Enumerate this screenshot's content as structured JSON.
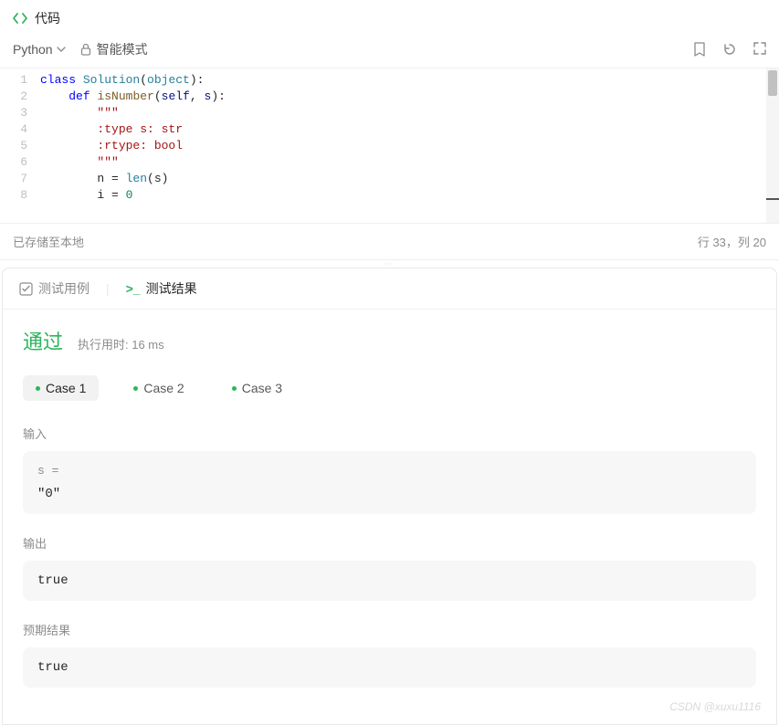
{
  "header": {
    "title": "代码"
  },
  "toolbar": {
    "language": "Python",
    "mode": "智能模式"
  },
  "editor": {
    "lines": [
      [
        [
          "kw",
          "class "
        ],
        [
          "cls",
          "Solution"
        ],
        [
          "",
          "("
        ],
        [
          "bi",
          "object"
        ],
        [
          "",
          "):"
        ]
      ],
      [
        [
          "",
          "    "
        ],
        [
          "kw",
          "def "
        ],
        [
          "fn",
          "isNumber"
        ],
        [
          "",
          "("
        ],
        [
          "param",
          "self"
        ],
        [
          "",
          ", "
        ],
        [
          "param",
          "s"
        ],
        [
          "",
          "):"
        ]
      ],
      [
        [
          "",
          "        "
        ],
        [
          "str",
          "\"\"\""
        ]
      ],
      [
        [
          "",
          "        "
        ],
        [
          "str",
          ":type s: str"
        ]
      ],
      [
        [
          "",
          "        "
        ],
        [
          "str",
          ":rtype: bool"
        ]
      ],
      [
        [
          "",
          "        "
        ],
        [
          "str",
          "\"\"\""
        ]
      ],
      [
        [
          "",
          "        n = "
        ],
        [
          "bi",
          "len"
        ],
        [
          "",
          "(s)"
        ]
      ],
      [
        [
          "",
          "        i = "
        ],
        [
          "num",
          "0"
        ]
      ]
    ]
  },
  "status": {
    "saved": "已存储至本地",
    "cursor": "行 33，列 20"
  },
  "tabs": {
    "testcase": "测试用例",
    "result": "测试结果"
  },
  "result": {
    "status": "通过",
    "runtime_label": "执行用时: 16 ms",
    "cases": [
      "Case 1",
      "Case 2",
      "Case 3"
    ],
    "active_case": 0,
    "input_label": "输入",
    "input_var": "s =",
    "input_value": "\"0\"",
    "output_label": "输出",
    "output_value": "true",
    "expected_label": "预期结果",
    "expected_value": "true"
  },
  "watermark": "CSDN @xuxu1116"
}
